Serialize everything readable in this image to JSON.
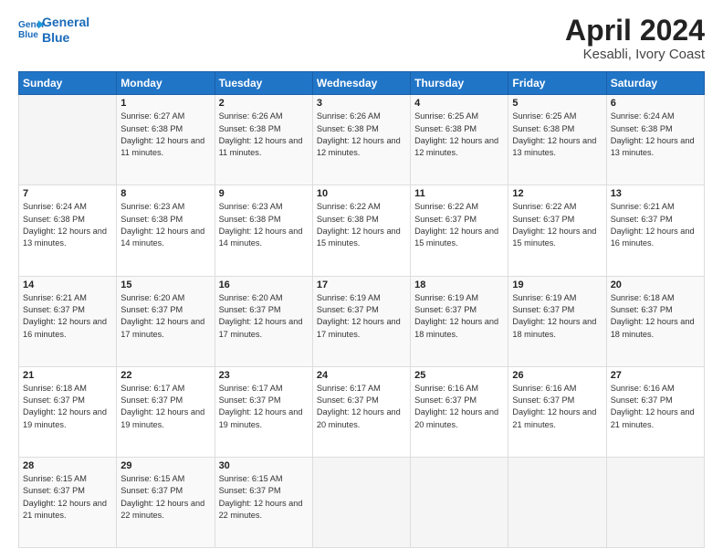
{
  "header": {
    "logo_line1": "General",
    "logo_line2": "Blue",
    "title": "April 2024",
    "subtitle": "Kesabli, Ivory Coast"
  },
  "weekdays": [
    "Sunday",
    "Monday",
    "Tuesday",
    "Wednesday",
    "Thursday",
    "Friday",
    "Saturday"
  ],
  "weeks": [
    [
      {
        "day": "",
        "sunrise": "",
        "sunset": "",
        "daylight": ""
      },
      {
        "day": "1",
        "sunrise": "Sunrise: 6:27 AM",
        "sunset": "Sunset: 6:38 PM",
        "daylight": "Daylight: 12 hours and 11 minutes."
      },
      {
        "day": "2",
        "sunrise": "Sunrise: 6:26 AM",
        "sunset": "Sunset: 6:38 PM",
        "daylight": "Daylight: 12 hours and 11 minutes."
      },
      {
        "day": "3",
        "sunrise": "Sunrise: 6:26 AM",
        "sunset": "Sunset: 6:38 PM",
        "daylight": "Daylight: 12 hours and 12 minutes."
      },
      {
        "day": "4",
        "sunrise": "Sunrise: 6:25 AM",
        "sunset": "Sunset: 6:38 PM",
        "daylight": "Daylight: 12 hours and 12 minutes."
      },
      {
        "day": "5",
        "sunrise": "Sunrise: 6:25 AM",
        "sunset": "Sunset: 6:38 PM",
        "daylight": "Daylight: 12 hours and 13 minutes."
      },
      {
        "day": "6",
        "sunrise": "Sunrise: 6:24 AM",
        "sunset": "Sunset: 6:38 PM",
        "daylight": "Daylight: 12 hours and 13 minutes."
      }
    ],
    [
      {
        "day": "7",
        "sunrise": "Sunrise: 6:24 AM",
        "sunset": "Sunset: 6:38 PM",
        "daylight": "Daylight: 12 hours and 13 minutes."
      },
      {
        "day": "8",
        "sunrise": "Sunrise: 6:23 AM",
        "sunset": "Sunset: 6:38 PM",
        "daylight": "Daylight: 12 hours and 14 minutes."
      },
      {
        "day": "9",
        "sunrise": "Sunrise: 6:23 AM",
        "sunset": "Sunset: 6:38 PM",
        "daylight": "Daylight: 12 hours and 14 minutes."
      },
      {
        "day": "10",
        "sunrise": "Sunrise: 6:22 AM",
        "sunset": "Sunset: 6:38 PM",
        "daylight": "Daylight: 12 hours and 15 minutes."
      },
      {
        "day": "11",
        "sunrise": "Sunrise: 6:22 AM",
        "sunset": "Sunset: 6:37 PM",
        "daylight": "Daylight: 12 hours and 15 minutes."
      },
      {
        "day": "12",
        "sunrise": "Sunrise: 6:22 AM",
        "sunset": "Sunset: 6:37 PM",
        "daylight": "Daylight: 12 hours and 15 minutes."
      },
      {
        "day": "13",
        "sunrise": "Sunrise: 6:21 AM",
        "sunset": "Sunset: 6:37 PM",
        "daylight": "Daylight: 12 hours and 16 minutes."
      }
    ],
    [
      {
        "day": "14",
        "sunrise": "Sunrise: 6:21 AM",
        "sunset": "Sunset: 6:37 PM",
        "daylight": "Daylight: 12 hours and 16 minutes."
      },
      {
        "day": "15",
        "sunrise": "Sunrise: 6:20 AM",
        "sunset": "Sunset: 6:37 PM",
        "daylight": "Daylight: 12 hours and 17 minutes."
      },
      {
        "day": "16",
        "sunrise": "Sunrise: 6:20 AM",
        "sunset": "Sunset: 6:37 PM",
        "daylight": "Daylight: 12 hours and 17 minutes."
      },
      {
        "day": "17",
        "sunrise": "Sunrise: 6:19 AM",
        "sunset": "Sunset: 6:37 PM",
        "daylight": "Daylight: 12 hours and 17 minutes."
      },
      {
        "day": "18",
        "sunrise": "Sunrise: 6:19 AM",
        "sunset": "Sunset: 6:37 PM",
        "daylight": "Daylight: 12 hours and 18 minutes."
      },
      {
        "day": "19",
        "sunrise": "Sunrise: 6:19 AM",
        "sunset": "Sunset: 6:37 PM",
        "daylight": "Daylight: 12 hours and 18 minutes."
      },
      {
        "day": "20",
        "sunrise": "Sunrise: 6:18 AM",
        "sunset": "Sunset: 6:37 PM",
        "daylight": "Daylight: 12 hours and 18 minutes."
      }
    ],
    [
      {
        "day": "21",
        "sunrise": "Sunrise: 6:18 AM",
        "sunset": "Sunset: 6:37 PM",
        "daylight": "Daylight: 12 hours and 19 minutes."
      },
      {
        "day": "22",
        "sunrise": "Sunrise: 6:17 AM",
        "sunset": "Sunset: 6:37 PM",
        "daylight": "Daylight: 12 hours and 19 minutes."
      },
      {
        "day": "23",
        "sunrise": "Sunrise: 6:17 AM",
        "sunset": "Sunset: 6:37 PM",
        "daylight": "Daylight: 12 hours and 19 minutes."
      },
      {
        "day": "24",
        "sunrise": "Sunrise: 6:17 AM",
        "sunset": "Sunset: 6:37 PM",
        "daylight": "Daylight: 12 hours and 20 minutes."
      },
      {
        "day": "25",
        "sunrise": "Sunrise: 6:16 AM",
        "sunset": "Sunset: 6:37 PM",
        "daylight": "Daylight: 12 hours and 20 minutes."
      },
      {
        "day": "26",
        "sunrise": "Sunrise: 6:16 AM",
        "sunset": "Sunset: 6:37 PM",
        "daylight": "Daylight: 12 hours and 21 minutes."
      },
      {
        "day": "27",
        "sunrise": "Sunrise: 6:16 AM",
        "sunset": "Sunset: 6:37 PM",
        "daylight": "Daylight: 12 hours and 21 minutes."
      }
    ],
    [
      {
        "day": "28",
        "sunrise": "Sunrise: 6:15 AM",
        "sunset": "Sunset: 6:37 PM",
        "daylight": "Daylight: 12 hours and 21 minutes."
      },
      {
        "day": "29",
        "sunrise": "Sunrise: 6:15 AM",
        "sunset": "Sunset: 6:37 PM",
        "daylight": "Daylight: 12 hours and 22 minutes."
      },
      {
        "day": "30",
        "sunrise": "Sunrise: 6:15 AM",
        "sunset": "Sunset: 6:37 PM",
        "daylight": "Daylight: 12 hours and 22 minutes."
      },
      {
        "day": "",
        "sunrise": "",
        "sunset": "",
        "daylight": ""
      },
      {
        "day": "",
        "sunrise": "",
        "sunset": "",
        "daylight": ""
      },
      {
        "day": "",
        "sunrise": "",
        "sunset": "",
        "daylight": ""
      },
      {
        "day": "",
        "sunrise": "",
        "sunset": "",
        "daylight": ""
      }
    ]
  ]
}
